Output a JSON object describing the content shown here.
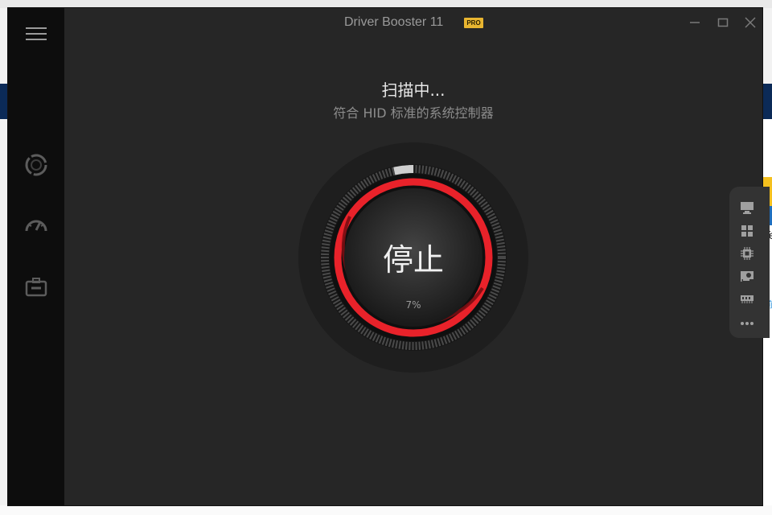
{
  "window": {
    "title": "Driver Booster 11",
    "badge": "PRO"
  },
  "scan": {
    "status": "扫描中...",
    "current_item": "符合 HID 标准的系统控制器",
    "button_label": "停止",
    "progress_text": "7%",
    "progress": 0.07
  },
  "sidebar": {
    "items": [
      "menu-icon",
      "scan-icon",
      "boost-icon",
      "toolbox-icon"
    ]
  },
  "right_dock": {
    "items": [
      "monitor-icon",
      "windows-icon",
      "cpu-icon",
      "graphics-card-icon",
      "memory-icon",
      "more-icon"
    ]
  },
  "background": {
    "right_text": "Te",
    "right_link": "前"
  },
  "colors": {
    "accent": "#e8222a",
    "badge": "#e8b530",
    "window_bg": "#262626",
    "sidebar_bg": "#0d0d0d"
  }
}
